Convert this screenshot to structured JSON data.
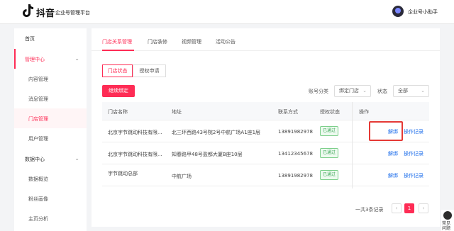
{
  "header": {
    "brand": "抖音",
    "platform": "企业号管理平台",
    "assistant": "企业号小助手"
  },
  "sidebar": {
    "items": [
      {
        "label": "首页",
        "type": "group"
      },
      {
        "label": "管理中心",
        "type": "group",
        "active": true
      },
      {
        "label": "内容管理",
        "type": "sub"
      },
      {
        "label": "消息管理",
        "type": "sub"
      },
      {
        "label": "门店管理",
        "type": "sub",
        "active": true
      },
      {
        "label": "用户管理",
        "type": "sub"
      },
      {
        "label": "数据中心",
        "type": "group"
      },
      {
        "label": "数据概览",
        "type": "sub"
      },
      {
        "label": "粉丝画像",
        "type": "sub"
      },
      {
        "label": "主页分析",
        "type": "sub"
      }
    ]
  },
  "tabs": [
    "门店关系管理",
    "门店装修",
    "视频管理",
    "活动公告"
  ],
  "segments": [
    "门店状态",
    "授权申请"
  ],
  "actions": {
    "bind": "继续绑定"
  },
  "filters": {
    "account_label": "账号分类",
    "account_value": "绑定门店",
    "status_label": "状态",
    "status_value": "全部"
  },
  "table": {
    "columns": [
      "门店名称",
      "地址",
      "联系方式",
      "授权状态",
      "操作"
    ],
    "rows": [
      {
        "name": "北京字节跳动科技有限...",
        "address": "北三环西路43号院2号中航广场A1座1层",
        "phone": "13891982978",
        "status": "已通过",
        "unbind": "解绑",
        "log": "操作记录"
      },
      {
        "name": "北京字节跳动科技有限...",
        "address": "知春路甲48号盈都大厦B座10层",
        "phone": "13412345678",
        "status": "已通过",
        "unbind": "解绑",
        "log": "操作记录"
      },
      {
        "name": "字节跳动总部",
        "address": "中航广场",
        "phone": "13891982978",
        "status": "已通过",
        "unbind": "解绑",
        "log": "操作记录"
      }
    ]
  },
  "pagination": {
    "total": "一共3条记录",
    "current": "1",
    "prev": "‹",
    "next": "›"
  },
  "corner": {
    "label": "常见问题"
  },
  "colors": {
    "accent": "#fe2c55",
    "link": "#1f6feb",
    "success": "#3aa655"
  }
}
